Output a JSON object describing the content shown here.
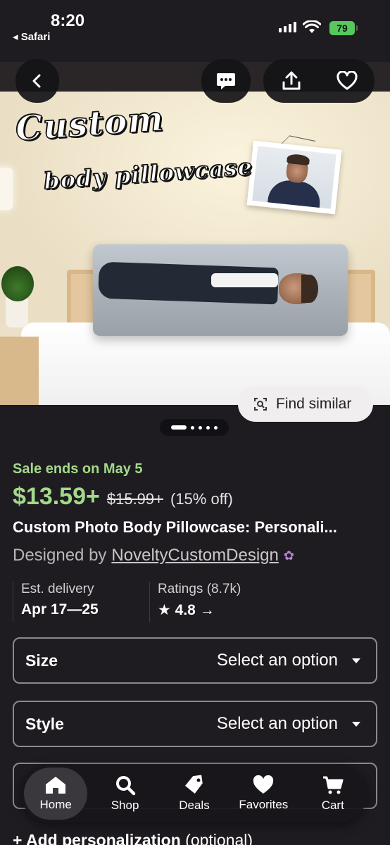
{
  "status_bar": {
    "time": "8:20",
    "back_app": "◂ Safari",
    "battery": "79"
  },
  "hero": {
    "script_line_1": "Custom",
    "script_line_2": "body pillowcase"
  },
  "find_similar": {
    "label": "Find similar"
  },
  "listing": {
    "sale_text": "Sale ends on May 5",
    "price": "$13.59+",
    "original_price": "$15.99+",
    "discount": "(15% off)",
    "title": "Custom Photo Body Pillowcase: Personali...",
    "designed_by": "Designed by",
    "shop_name": "NoveltyCustomDesign"
  },
  "meta": {
    "delivery_label": "Est. delivery",
    "delivery_value": "Apr 17—25",
    "ratings_label": "Ratings (8.7k)",
    "ratings_value": "★ 4.8 →"
  },
  "options": {
    "size_label": "Size",
    "size_value": "Select an option",
    "style_label": "Style",
    "style_value": "Select an option"
  },
  "personalization": {
    "label": "+ Add personalization",
    "optional": " (optional)"
  },
  "bottom_nav": {
    "items": [
      {
        "label": "Home",
        "icon": "home-icon"
      },
      {
        "label": "Shop",
        "icon": "search-icon"
      },
      {
        "label": "Deals",
        "icon": "tag-icon"
      },
      {
        "label": "Favorites",
        "icon": "heart-icon"
      },
      {
        "label": "Cart",
        "icon": "cart-icon"
      }
    ]
  },
  "colors": {
    "sale_green": "#a3d98a",
    "background": "#1f1c21",
    "badge_purple": "#b985d9"
  }
}
